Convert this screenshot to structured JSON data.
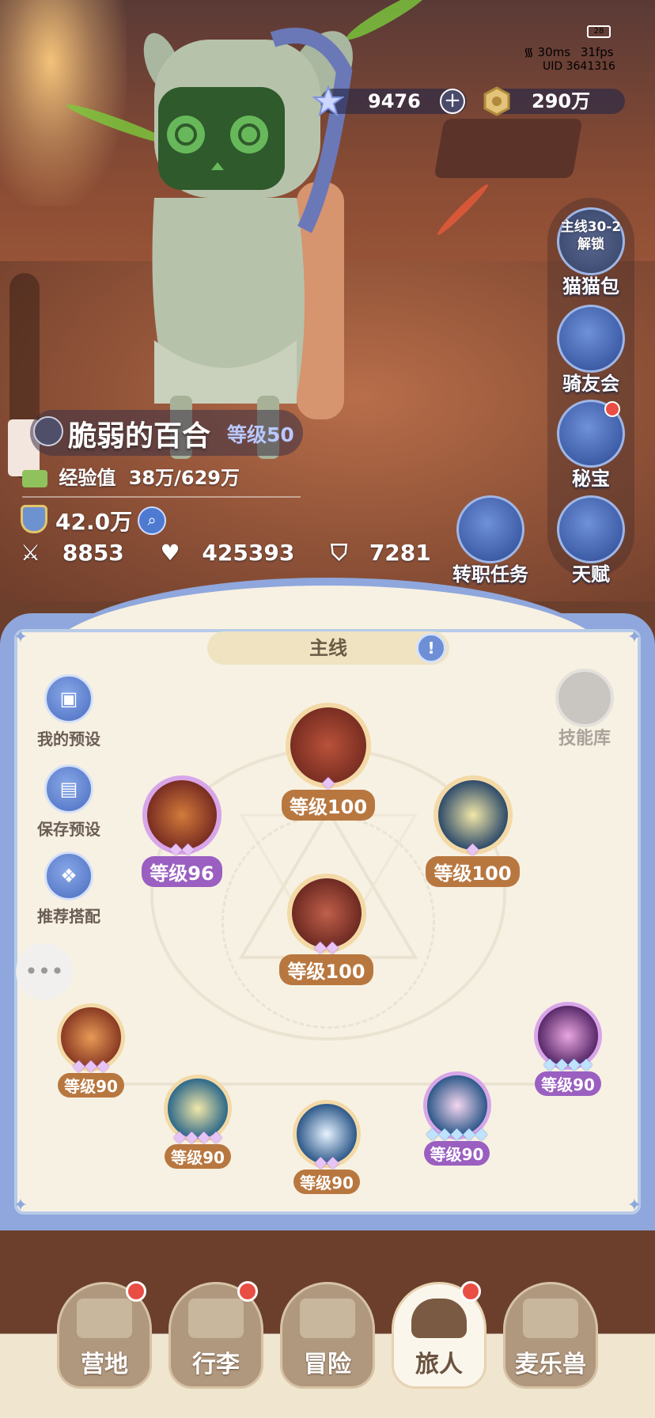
{
  "status": {
    "battery": "28",
    "ping": "30ms",
    "fps": "31fps",
    "uid": "UID 3641316"
  },
  "currency": {
    "gems": "9476",
    "gold": "290万",
    "gem_icon": "star-crystal-icon",
    "gold_icon": "gold-coin-icon"
  },
  "sidebar": {
    "cat_bag": {
      "lock_line1": "主线30-2",
      "lock_line2": "解锁",
      "label": "猫猫包",
      "icon": "lock-icon"
    },
    "rider_club": {
      "label": "骑友会",
      "icon": "horse-head-icon"
    },
    "treasure": {
      "label": "秘宝",
      "icon": "treasure-chest-icon",
      "badge": true
    },
    "talent": {
      "label": "天赋",
      "icon": "brain-head-icon"
    }
  },
  "job_quest": {
    "label": "转职任务",
    "icon": "crown-icon"
  },
  "player": {
    "name": "脆弱的百合",
    "level": "等级50",
    "exp_label": "经验值",
    "exp_value": "38万/629万",
    "power": "42.0万",
    "attack": "8853",
    "hp": "425393",
    "defense": "7281"
  },
  "panel": {
    "tab_label": "主线",
    "tab_info": "!",
    "presets": [
      {
        "label": "我的预设",
        "icon": "card-icon"
      },
      {
        "label": "保存预设",
        "icon": "save-disk-icon"
      },
      {
        "label": "推荐搭配",
        "icon": "combo-icon"
      }
    ],
    "skill_library": {
      "label": "技能库",
      "icon": "skill-library-icon"
    },
    "chat_icon": "chat-bubble-icon"
  },
  "skills": [
    {
      "id": "top",
      "level": "等级100",
      "gems": "◆",
      "color": "#c2713a",
      "label_bg": "#b8773f"
    },
    {
      "id": "left",
      "level": "等级96",
      "gems": "◆◆",
      "color": "#a060b8",
      "label_bg": "#9a5fc0"
    },
    {
      "id": "right",
      "level": "等级100",
      "gems": "◆",
      "color": "#c2913a",
      "label_bg": "#b8773f"
    },
    {
      "id": "center",
      "level": "等级100",
      "gems": "◆◆",
      "color": "#c2713a",
      "label_bg": "#b8773f"
    },
    {
      "id": "b1",
      "level": "等级90",
      "gems": "◆◆◆",
      "color": "#c2713a",
      "label_bg": "#b8773f"
    },
    {
      "id": "b2",
      "level": "等级90",
      "gems": "◆◆◆◆",
      "color": "#c2913a",
      "label_bg": "#b8773f"
    },
    {
      "id": "b3",
      "level": "等级90",
      "gems": "◆◆",
      "color": "#c2913a",
      "label_bg": "#b8773f"
    },
    {
      "id": "b4",
      "level": "等级90",
      "gems": "◆◆◆◆◆",
      "color": "#a060b8",
      "label_bg": "#9a5fc0"
    },
    {
      "id": "b5",
      "level": "等级90",
      "gems": "◆◆◆◆",
      "color": "#a060b8",
      "label_bg": "#9a5fc0"
    }
  ],
  "nav": [
    {
      "label": "营地",
      "icon": "castle-icon",
      "badge": true,
      "active": false
    },
    {
      "label": "行李",
      "icon": "luggage-icon",
      "badge": true,
      "active": false
    },
    {
      "label": "冒险",
      "icon": "crossed-swords-icon",
      "badge": false,
      "active": false
    },
    {
      "label": "旅人",
      "icon": "traveler-avatar-icon",
      "badge": true,
      "active": true
    },
    {
      "label": "麦乐兽",
      "icon": "fox-pet-icon",
      "badge": false,
      "active": false
    }
  ]
}
